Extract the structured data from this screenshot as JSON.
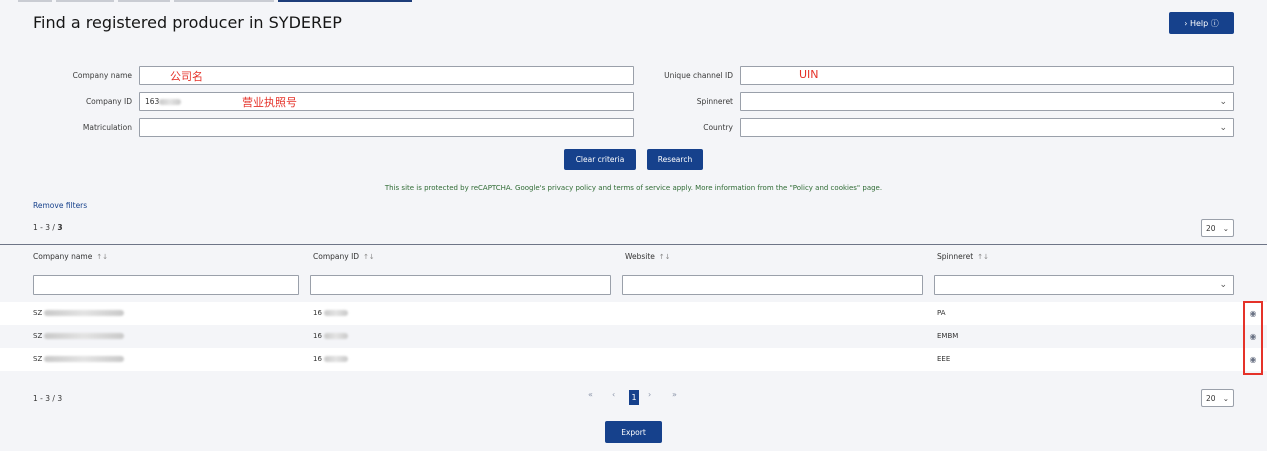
{
  "title": "Find a registered producer in SYDEREP",
  "help_button": "› Help ⓘ",
  "form": {
    "company_name_label": "Company name",
    "company_name_annotation": "公司名",
    "company_id_label": "Company ID",
    "company_id_value": "163",
    "company_id_annotation": "营业执照号",
    "matriculation_label": "Matriculation",
    "unique_channel_label": "Unique channel ID",
    "unique_channel_annotation": "UIN",
    "spinneret_label": "Spinneret",
    "country_label": "Country"
  },
  "buttons": {
    "clear": "Clear criteria",
    "research": "Research",
    "export": "Export"
  },
  "captcha_text": "This site is protected by reCAPTCHA. Google's privacy policy and terms of service apply. More information from the \"Policy and cookies\" page.",
  "remove_filters": "Remove filters",
  "count_top": "1 - 3 / ",
  "count_total": "3",
  "count_bottom": "1 - 3 / 3",
  "page_size": "20",
  "table": {
    "headers": [
      "Company name",
      "Company ID",
      "Website",
      "Spinneret"
    ],
    "rows": [
      {
        "company": "SZ",
        "company_id": "16",
        "website": "",
        "spinneret": "PA"
      },
      {
        "company": "SZ",
        "company_id": "16",
        "website": "",
        "spinneret": "EMBM"
      },
      {
        "company": "SZ",
        "company_id": "16",
        "website": "",
        "spinneret": "EEE"
      }
    ]
  },
  "pagination": {
    "first": "«",
    "prev": "‹",
    "current": "1",
    "next": "›",
    "last": "»"
  },
  "icons": {
    "sort": "sort-icon",
    "eye": "eye-icon",
    "chevron": "chevron-down-icon"
  },
  "colors": {
    "primary": "#16418c",
    "annotation": "#e53229",
    "captcha": "#2f6b34"
  }
}
